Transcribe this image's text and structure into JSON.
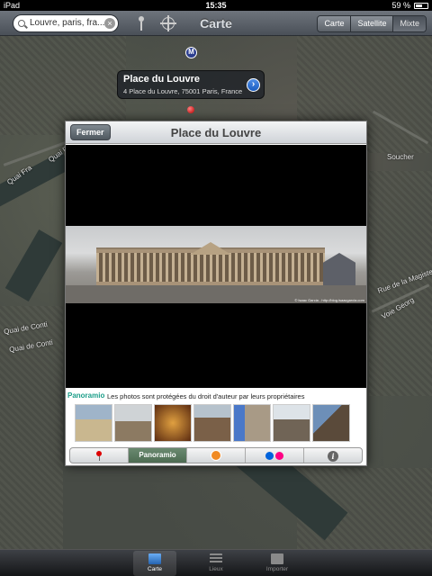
{
  "status_bar": {
    "carrier": "iPad",
    "time": "15:35",
    "battery_percent": "59 %",
    "battery_level": 0.59
  },
  "nav": {
    "search_value": "Louvre, paris, fra...",
    "title": "Carte",
    "map_types": [
      {
        "label": "Carte",
        "active": false
      },
      {
        "label": "Satellite",
        "active": false
      },
      {
        "label": "Mixte",
        "active": true
      }
    ]
  },
  "map": {
    "metro_label": "M",
    "street_labels": [
      "Quai Fra",
      "Quai Fra",
      "Quai de Conti",
      "Quai de Conti",
      "Rue de la Magiste",
      "Voie Georg",
      "Soucher"
    ],
    "callout": {
      "title": "Place du Louvre",
      "address": "4 Place du Louvre, 75001 Paris, France"
    }
  },
  "modal": {
    "close_label": "Fermer",
    "title": "Place du Louvre",
    "photo_caption_title": "Musée du Louvre, rue de lAmiral de Coligny",
    "photo_caption_by": "par",
    "photo_caption_author": "Isaac Garcia",
    "photo_credit": "© Isaac Garcia - http://blog.isaacgarcia.com",
    "panoramio_logo": "Panoramio",
    "copyright_notice": "Les photos sont protégées du droit d'auteur par leurs propriétaires",
    "toolbar": [
      {
        "icon": "pin-icon",
        "active": false
      },
      {
        "icon": "panoramio-icon",
        "label": "Panoramio",
        "active": true
      },
      {
        "icon": "user-icon",
        "active": false
      },
      {
        "icon": "flickr-icon",
        "active": false
      },
      {
        "icon": "info-icon",
        "label": "i",
        "active": false
      }
    ]
  },
  "tab_bar": {
    "tabs": [
      {
        "label": "Carte",
        "icon": "map-icon",
        "active": true
      },
      {
        "label": "Lieux",
        "icon": "list-icon",
        "active": false
      },
      {
        "label": "Importer",
        "icon": "download-icon",
        "active": false
      }
    ]
  },
  "colors": {
    "nav_bar": "#5c6269",
    "disclosure": "#1a5cc0",
    "pin": "#c00000",
    "panoramio": "#1a9d88"
  }
}
